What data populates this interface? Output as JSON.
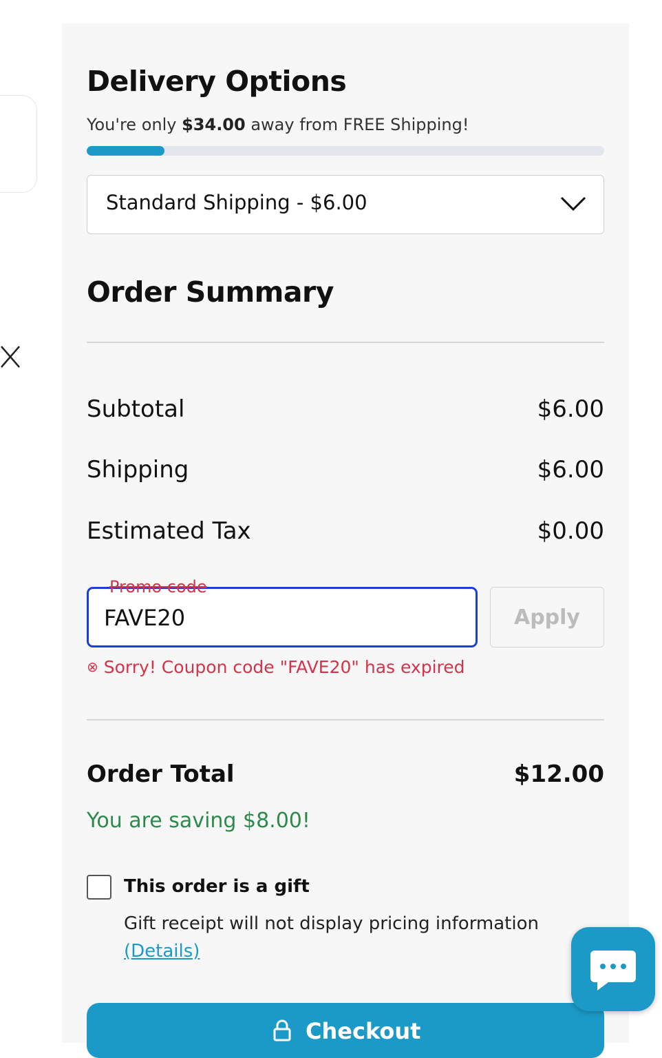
{
  "delivery": {
    "title": "Delivery Options",
    "free_shipping_prefix": "You're only ",
    "free_shipping_amount": "$34.00",
    "free_shipping_suffix": " away from FREE Shipping!",
    "progress_fraction": 0.15,
    "selected_option": "Standard Shipping - $6.00"
  },
  "summary": {
    "title": "Order Summary",
    "subtotal_label": "Subtotal",
    "subtotal_value": "$6.00",
    "shipping_label": "Shipping",
    "shipping_value": "$6.00",
    "tax_label": "Estimated Tax",
    "tax_value": "$0.00"
  },
  "promo": {
    "label": "Promo code",
    "value": "FAVE20",
    "apply_label": "Apply",
    "error_icon": "⊗",
    "error_text": "Sorry! Coupon code \"FAVE20\" has expired"
  },
  "total": {
    "label": "Order Total",
    "value": "$12.00",
    "saving_text": "You are saving $8.00!"
  },
  "gift": {
    "label": "This order is a gift",
    "note": "Gift receipt will not display pricing information",
    "details_link": "(Details)"
  },
  "checkout": {
    "label": "Checkout"
  },
  "colors": {
    "accent": "#1c9ac7",
    "error": "#d6334a",
    "saving": "#2c8a4a",
    "focus_border": "#1a3ed6"
  },
  "icons": {
    "close": "close-icon",
    "chevron": "chevron-down-icon",
    "lock": "lock-icon",
    "chat": "chat-icon",
    "error": "error-circle-icon"
  }
}
